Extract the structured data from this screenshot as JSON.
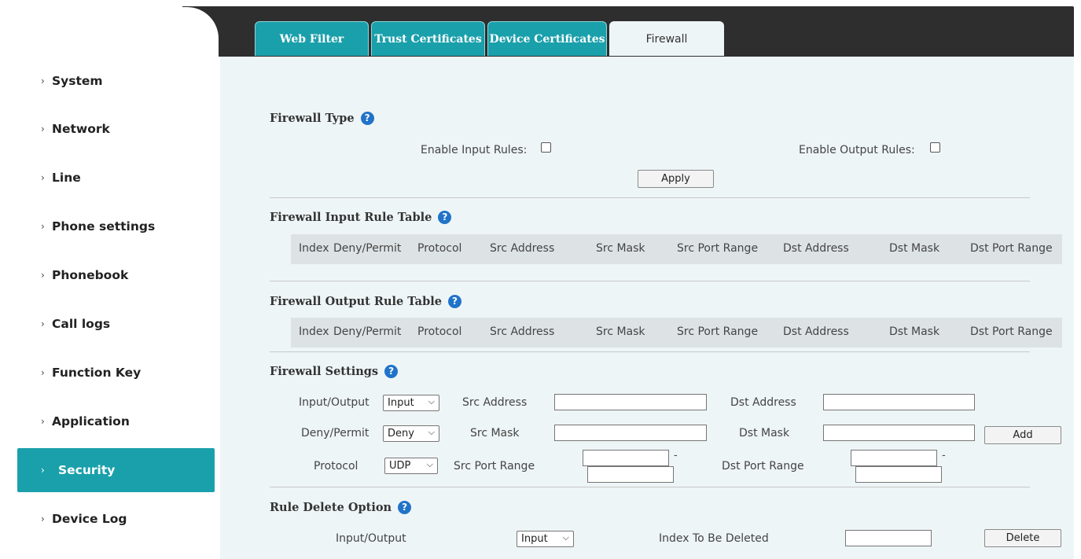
{
  "sidebar": {
    "items": [
      {
        "label": "System"
      },
      {
        "label": "Network"
      },
      {
        "label": "Line"
      },
      {
        "label": "Phone settings"
      },
      {
        "label": "Phonebook"
      },
      {
        "label": "Call logs"
      },
      {
        "label": "Function Key"
      },
      {
        "label": "Application"
      },
      {
        "label": "Security"
      },
      {
        "label": "Device Log"
      }
    ],
    "active": "Security",
    "chevron": "›"
  },
  "tabs": [
    {
      "label": "Web Filter"
    },
    {
      "label": "Trust Certificates"
    },
    {
      "label": "Device Certificates"
    },
    {
      "label": "Firewall"
    }
  ],
  "firewall_type": {
    "title": "Firewall Type",
    "enable_input_label": "Enable Input Rules:",
    "enable_input_checked": false,
    "enable_output_label": "Enable Output Rules:",
    "enable_output_checked": false,
    "apply_label": "Apply"
  },
  "input_table": {
    "title": "Firewall Input Rule Table",
    "columns": [
      "Index",
      "Deny/Permit",
      "Protocol",
      "Src Address",
      "Src Mask",
      "Src Port Range",
      "Dst Address",
      "Dst Mask",
      "Dst Port Range"
    ]
  },
  "output_table": {
    "title": "Firewall Output Rule Table",
    "columns": [
      "Index",
      "Deny/Permit",
      "Protocol",
      "Src Address",
      "Src Mask",
      "Src Port Range",
      "Dst Address",
      "Dst Mask",
      "Dst Port Range"
    ]
  },
  "settings": {
    "title": "Firewall Settings",
    "input_output_label": "Input/Output",
    "input_output_value": "Input",
    "deny_permit_label": "Deny/Permit",
    "deny_permit_value": "Deny",
    "protocol_label": "Protocol",
    "protocol_value": "UDP",
    "src_address_label": "Src Address",
    "src_mask_label": "Src Mask",
    "src_port_range_label": "Src Port Range",
    "dst_address_label": "Dst Address",
    "dst_mask_label": "Dst Mask",
    "dst_port_range_label": "Dst Port Range",
    "range_separator": "-",
    "add_label": "Add"
  },
  "delete_option": {
    "title": "Rule Delete Option",
    "input_output_label": "Input/Output",
    "input_output_value": "Input",
    "index_label": "Index To Be Deleted",
    "delete_label": "Delete"
  },
  "icons": {
    "help": "help-circle-icon",
    "dropdown": "chevron-down-icon"
  },
  "colors": {
    "accent": "#1aa0ab",
    "topbar": "#2e2e2e",
    "content_bg": "#eef5f6",
    "help_icon": "#2073c8"
  }
}
